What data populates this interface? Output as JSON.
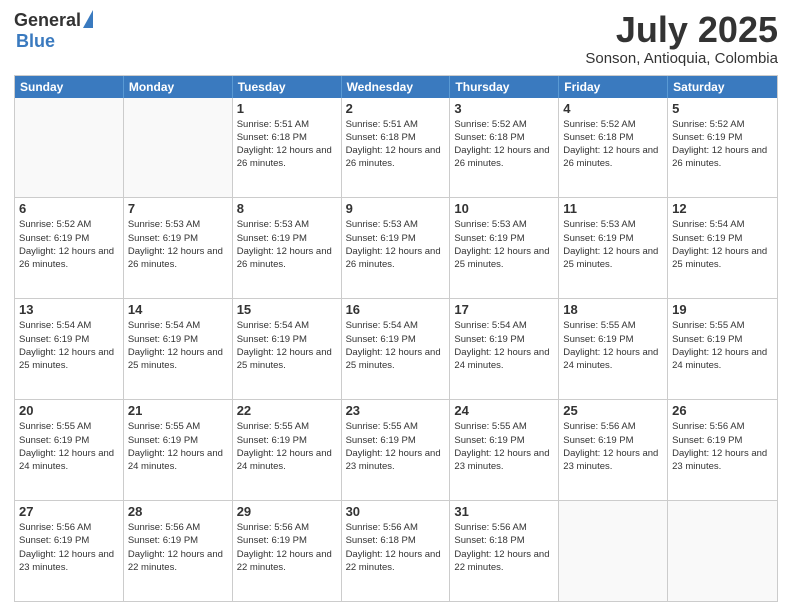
{
  "logo": {
    "general": "General",
    "blue": "Blue"
  },
  "header": {
    "month": "July 2025",
    "location": "Sonson, Antioquia, Colombia"
  },
  "weekdays": [
    "Sunday",
    "Monday",
    "Tuesday",
    "Wednesday",
    "Thursday",
    "Friday",
    "Saturday"
  ],
  "weeks": [
    [
      {
        "day": "",
        "empty": true
      },
      {
        "day": "",
        "empty": true
      },
      {
        "day": "1",
        "sunrise": "Sunrise: 5:51 AM",
        "sunset": "Sunset: 6:18 PM",
        "daylight": "Daylight: 12 hours and 26 minutes."
      },
      {
        "day": "2",
        "sunrise": "Sunrise: 5:51 AM",
        "sunset": "Sunset: 6:18 PM",
        "daylight": "Daylight: 12 hours and 26 minutes."
      },
      {
        "day": "3",
        "sunrise": "Sunrise: 5:52 AM",
        "sunset": "Sunset: 6:18 PM",
        "daylight": "Daylight: 12 hours and 26 minutes."
      },
      {
        "day": "4",
        "sunrise": "Sunrise: 5:52 AM",
        "sunset": "Sunset: 6:18 PM",
        "daylight": "Daylight: 12 hours and 26 minutes."
      },
      {
        "day": "5",
        "sunrise": "Sunrise: 5:52 AM",
        "sunset": "Sunset: 6:19 PM",
        "daylight": "Daylight: 12 hours and 26 minutes."
      }
    ],
    [
      {
        "day": "6",
        "sunrise": "Sunrise: 5:52 AM",
        "sunset": "Sunset: 6:19 PM",
        "daylight": "Daylight: 12 hours and 26 minutes."
      },
      {
        "day": "7",
        "sunrise": "Sunrise: 5:53 AM",
        "sunset": "Sunset: 6:19 PM",
        "daylight": "Daylight: 12 hours and 26 minutes."
      },
      {
        "day": "8",
        "sunrise": "Sunrise: 5:53 AM",
        "sunset": "Sunset: 6:19 PM",
        "daylight": "Daylight: 12 hours and 26 minutes."
      },
      {
        "day": "9",
        "sunrise": "Sunrise: 5:53 AM",
        "sunset": "Sunset: 6:19 PM",
        "daylight": "Daylight: 12 hours and 26 minutes."
      },
      {
        "day": "10",
        "sunrise": "Sunrise: 5:53 AM",
        "sunset": "Sunset: 6:19 PM",
        "daylight": "Daylight: 12 hours and 25 minutes."
      },
      {
        "day": "11",
        "sunrise": "Sunrise: 5:53 AM",
        "sunset": "Sunset: 6:19 PM",
        "daylight": "Daylight: 12 hours and 25 minutes."
      },
      {
        "day": "12",
        "sunrise": "Sunrise: 5:54 AM",
        "sunset": "Sunset: 6:19 PM",
        "daylight": "Daylight: 12 hours and 25 minutes."
      }
    ],
    [
      {
        "day": "13",
        "sunrise": "Sunrise: 5:54 AM",
        "sunset": "Sunset: 6:19 PM",
        "daylight": "Daylight: 12 hours and 25 minutes."
      },
      {
        "day": "14",
        "sunrise": "Sunrise: 5:54 AM",
        "sunset": "Sunset: 6:19 PM",
        "daylight": "Daylight: 12 hours and 25 minutes."
      },
      {
        "day": "15",
        "sunrise": "Sunrise: 5:54 AM",
        "sunset": "Sunset: 6:19 PM",
        "daylight": "Daylight: 12 hours and 25 minutes."
      },
      {
        "day": "16",
        "sunrise": "Sunrise: 5:54 AM",
        "sunset": "Sunset: 6:19 PM",
        "daylight": "Daylight: 12 hours and 25 minutes."
      },
      {
        "day": "17",
        "sunrise": "Sunrise: 5:54 AM",
        "sunset": "Sunset: 6:19 PM",
        "daylight": "Daylight: 12 hours and 24 minutes."
      },
      {
        "day": "18",
        "sunrise": "Sunrise: 5:55 AM",
        "sunset": "Sunset: 6:19 PM",
        "daylight": "Daylight: 12 hours and 24 minutes."
      },
      {
        "day": "19",
        "sunrise": "Sunrise: 5:55 AM",
        "sunset": "Sunset: 6:19 PM",
        "daylight": "Daylight: 12 hours and 24 minutes."
      }
    ],
    [
      {
        "day": "20",
        "sunrise": "Sunrise: 5:55 AM",
        "sunset": "Sunset: 6:19 PM",
        "daylight": "Daylight: 12 hours and 24 minutes."
      },
      {
        "day": "21",
        "sunrise": "Sunrise: 5:55 AM",
        "sunset": "Sunset: 6:19 PM",
        "daylight": "Daylight: 12 hours and 24 minutes."
      },
      {
        "day": "22",
        "sunrise": "Sunrise: 5:55 AM",
        "sunset": "Sunset: 6:19 PM",
        "daylight": "Daylight: 12 hours and 24 minutes."
      },
      {
        "day": "23",
        "sunrise": "Sunrise: 5:55 AM",
        "sunset": "Sunset: 6:19 PM",
        "daylight": "Daylight: 12 hours and 23 minutes."
      },
      {
        "day": "24",
        "sunrise": "Sunrise: 5:55 AM",
        "sunset": "Sunset: 6:19 PM",
        "daylight": "Daylight: 12 hours and 23 minutes."
      },
      {
        "day": "25",
        "sunrise": "Sunrise: 5:56 AM",
        "sunset": "Sunset: 6:19 PM",
        "daylight": "Daylight: 12 hours and 23 minutes."
      },
      {
        "day": "26",
        "sunrise": "Sunrise: 5:56 AM",
        "sunset": "Sunset: 6:19 PM",
        "daylight": "Daylight: 12 hours and 23 minutes."
      }
    ],
    [
      {
        "day": "27",
        "sunrise": "Sunrise: 5:56 AM",
        "sunset": "Sunset: 6:19 PM",
        "daylight": "Daylight: 12 hours and 23 minutes."
      },
      {
        "day": "28",
        "sunrise": "Sunrise: 5:56 AM",
        "sunset": "Sunset: 6:19 PM",
        "daylight": "Daylight: 12 hours and 22 minutes."
      },
      {
        "day": "29",
        "sunrise": "Sunrise: 5:56 AM",
        "sunset": "Sunset: 6:19 PM",
        "daylight": "Daylight: 12 hours and 22 minutes."
      },
      {
        "day": "30",
        "sunrise": "Sunrise: 5:56 AM",
        "sunset": "Sunset: 6:18 PM",
        "daylight": "Daylight: 12 hours and 22 minutes."
      },
      {
        "day": "31",
        "sunrise": "Sunrise: 5:56 AM",
        "sunset": "Sunset: 6:18 PM",
        "daylight": "Daylight: 12 hours and 22 minutes."
      },
      {
        "day": "",
        "empty": true
      },
      {
        "day": "",
        "empty": true
      }
    ]
  ]
}
